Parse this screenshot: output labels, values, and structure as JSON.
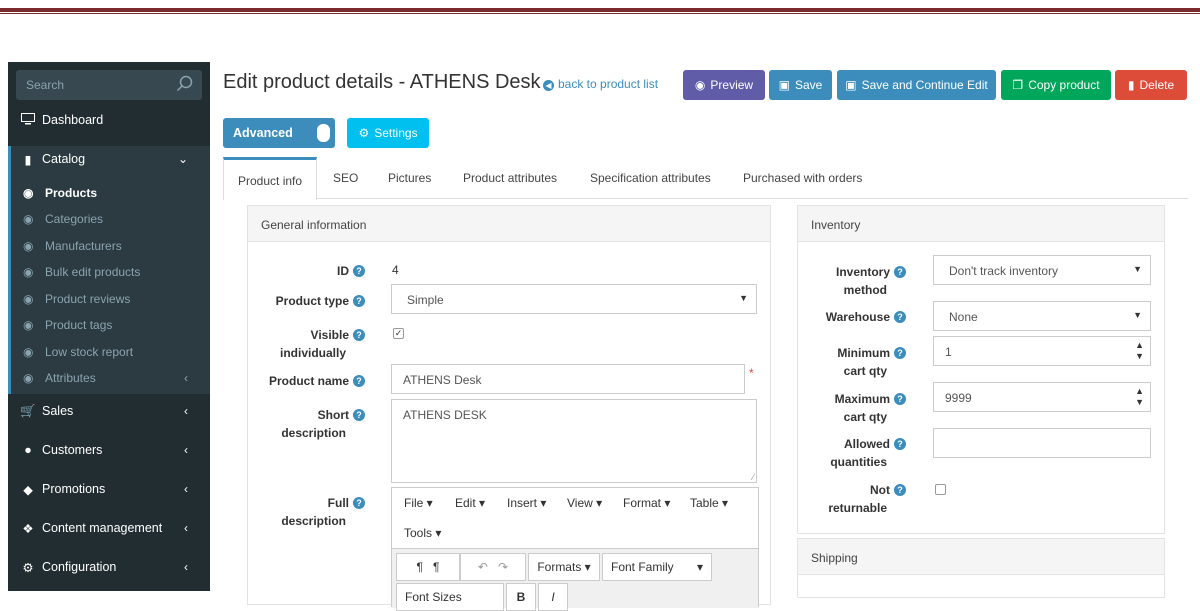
{
  "sidebar": {
    "search_placeholder": "Search",
    "dashboard": "Dashboard",
    "catalog": "Catalog",
    "catalog_items": [
      "Products",
      "Categories",
      "Manufacturers",
      "Bulk edit products",
      "Product reviews",
      "Product tags",
      "Low stock report",
      "Attributes"
    ],
    "sales": "Sales",
    "customers": "Customers",
    "promotions": "Promotions",
    "content_management": "Content management",
    "configuration": "Configuration"
  },
  "header": {
    "title": "Edit product details - ATHENS Desk",
    "back_link": "back to product list",
    "preview": "Preview",
    "save": "Save",
    "save_continue": "Save and Continue Edit",
    "copy": "Copy product",
    "delete": "Delete",
    "advanced": "Advanced",
    "settings": "Settings"
  },
  "tabs": [
    "Product info",
    "SEO",
    "Pictures",
    "Product attributes",
    "Specification attributes",
    "Purchased with orders"
  ],
  "general": {
    "heading": "General information",
    "id_label": "ID",
    "id_value": "4",
    "type_label": "Product type",
    "type_value": "Simple",
    "visible_label_1": "Visible",
    "visible_label_2": "individually",
    "name_label": "Product name",
    "name_value": "ATHENS Desk",
    "short_label_1": "Short",
    "short_label_2": "description",
    "short_value": "ATHENS DESK",
    "full_label_1": "Full",
    "full_label_2": "description",
    "editor_menu": [
      "File",
      "Edit",
      "Insert",
      "View",
      "Format",
      "Table",
      "Tools"
    ],
    "formats": "Formats",
    "font_family": "Font Family",
    "font_sizes": "Font Sizes"
  },
  "inventory": {
    "heading": "Inventory",
    "method_label_1": "Inventory",
    "method_label_2": "method",
    "method_value": "Don't track inventory",
    "warehouse_label": "Warehouse",
    "warehouse_value": "None",
    "min_label_1": "Minimum",
    "min_label_2": "cart qty",
    "min_value": "1",
    "max_label_1": "Maximum",
    "max_label_2": "cart qty",
    "max_value": "9999",
    "allowed_label_1": "Allowed",
    "allowed_label_2": "quantities",
    "notret_label_1": "Not",
    "notret_label_2": "returnable"
  },
  "shipping": {
    "heading": "Shipping"
  },
  "colors": {
    "primary": "#3c8dbc",
    "preview": "#605ca8",
    "save": "#3c8dbc",
    "copy": "#00a65a",
    "delete": "#dd4b39",
    "info": "#00c0ef"
  }
}
